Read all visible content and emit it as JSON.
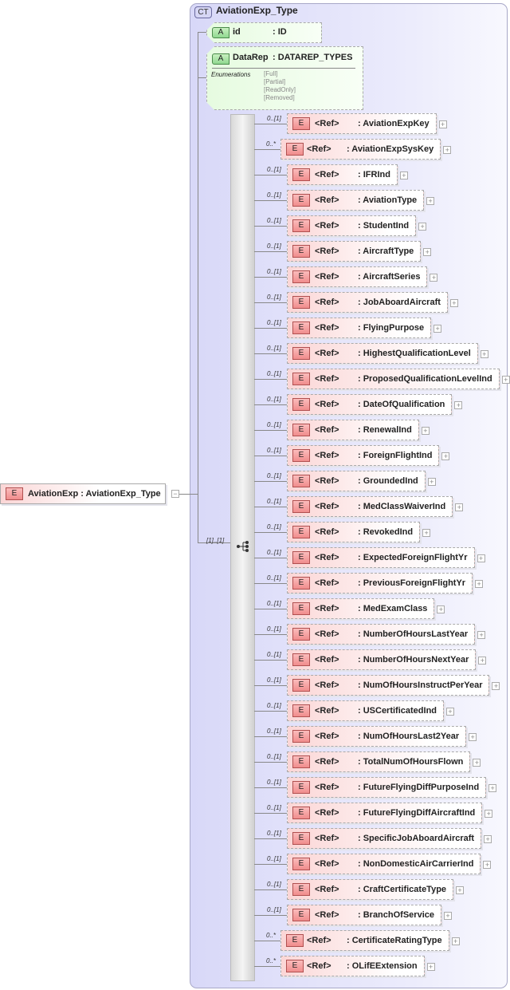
{
  "root": {
    "name": "AviationExp",
    "type": ": AviationExp_Type",
    "badge": "E",
    "toggle": "−"
  },
  "complex_type": {
    "badge": "CT",
    "title": "AviationExp_Type"
  },
  "attributes": [
    {
      "badge": "A",
      "name": "id",
      "type": ": ID"
    },
    {
      "badge": "A",
      "name": "DataRep",
      "type": ": DATAREP_TYPES",
      "enum_label": "Enumerations",
      "enums": [
        "[Full]",
        "[Partial]",
        "[ReadOnly]",
        "[Removed]"
      ]
    }
  ],
  "sequence": {
    "cardinality": "[1]..[1]"
  },
  "elements": [
    {
      "card": "0..[1]",
      "ref": "<Ref>",
      "name": ": AviationExpKey"
    },
    {
      "card": "0..*",
      "ref": "<Ref>",
      "name": ": AviationExpSysKey"
    },
    {
      "card": "0..[1]",
      "ref": "<Ref>",
      "name": ": IFRInd"
    },
    {
      "card": "0..[1]",
      "ref": "<Ref>",
      "name": ": AviationType"
    },
    {
      "card": "0..[1]",
      "ref": "<Ref>",
      "name": ": StudentInd"
    },
    {
      "card": "0..[1]",
      "ref": "<Ref>",
      "name": ": AircraftType"
    },
    {
      "card": "0..[1]",
      "ref": "<Ref>",
      "name": ": AircraftSeries"
    },
    {
      "card": "0..[1]",
      "ref": "<Ref>",
      "name": ": JobAboardAircraft"
    },
    {
      "card": "0..[1]",
      "ref": "<Ref>",
      "name": ": FlyingPurpose"
    },
    {
      "card": "0..[1]",
      "ref": "<Ref>",
      "name": ": HighestQualificationLevel"
    },
    {
      "card": "0..[1]",
      "ref": "<Ref>",
      "name": ": ProposedQualificationLevelInd"
    },
    {
      "card": "0..[1]",
      "ref": "<Ref>",
      "name": ": DateOfQualification"
    },
    {
      "card": "0..[1]",
      "ref": "<Ref>",
      "name": ": RenewalInd"
    },
    {
      "card": "0..[1]",
      "ref": "<Ref>",
      "name": ": ForeignFlightInd"
    },
    {
      "card": "0..[1]",
      "ref": "<Ref>",
      "name": ": GroundedInd"
    },
    {
      "card": "0..[1]",
      "ref": "<Ref>",
      "name": ": MedClassWaiverInd"
    },
    {
      "card": "0..[1]",
      "ref": "<Ref>",
      "name": ": RevokedInd"
    },
    {
      "card": "0..[1]",
      "ref": "<Ref>",
      "name": ": ExpectedForeignFlightYr"
    },
    {
      "card": "0..[1]",
      "ref": "<Ref>",
      "name": ": PreviousForeignFlightYr"
    },
    {
      "card": "0..[1]",
      "ref": "<Ref>",
      "name": ": MedExamClass"
    },
    {
      "card": "0..[1]",
      "ref": "<Ref>",
      "name": ": NumberOfHoursLastYear"
    },
    {
      "card": "0..[1]",
      "ref": "<Ref>",
      "name": ": NumberOfHoursNextYear"
    },
    {
      "card": "0..[1]",
      "ref": "<Ref>",
      "name": ": NumOfHoursInstructPerYear"
    },
    {
      "card": "0..[1]",
      "ref": "<Ref>",
      "name": ": USCertificatedInd"
    },
    {
      "card": "0..[1]",
      "ref": "<Ref>",
      "name": ": NumOfHoursLast2Year"
    },
    {
      "card": "0..[1]",
      "ref": "<Ref>",
      "name": ": TotalNumOfHoursFlown"
    },
    {
      "card": "0..[1]",
      "ref": "<Ref>",
      "name": ": FutureFlyingDiffPurposeInd"
    },
    {
      "card": "0..[1]",
      "ref": "<Ref>",
      "name": ": FutureFlyingDiffAircraftInd"
    },
    {
      "card": "0..[1]",
      "ref": "<Ref>",
      "name": ": SpecificJobAboardAircraft"
    },
    {
      "card": "0..[1]",
      "ref": "<Ref>",
      "name": ": NonDomesticAirCarrierInd"
    },
    {
      "card": "0..[1]",
      "ref": "<Ref>",
      "name": ": CraftCertificateType"
    },
    {
      "card": "0..[1]",
      "ref": "<Ref>",
      "name": ": BranchOfService"
    },
    {
      "card": "0..*",
      "ref": "<Ref>",
      "name": ": CertificateRatingType"
    },
    {
      "card": "0..*",
      "ref": "<Ref>",
      "name": ": OLifEExtension"
    }
  ]
}
